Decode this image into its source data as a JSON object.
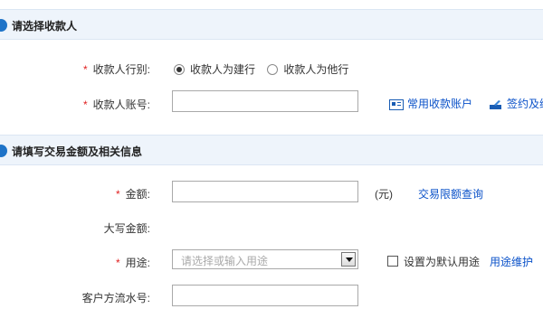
{
  "payee_section": {
    "title": "请选择收款人",
    "type_label": "收款人行别:",
    "type_options": [
      "收款人为建行",
      "收款人为他行"
    ],
    "account_label": "收款人账号:",
    "common_accounts_link": "常用收款账户",
    "sign_link": "签约及维护"
  },
  "amount_section": {
    "title": "请填写交易金额及相关信息",
    "amount_label": "金额:",
    "currency_unit": "(元)",
    "limit_query_link": "交易限额查询",
    "uppercase_label": "大写金额:",
    "purpose_label": "用途:",
    "purpose_placeholder": "请选择或输入用途",
    "default_purpose_label": "设置为默认用途",
    "purpose_maintain_link": "用途维护",
    "serial_label": "客户方流水号:"
  },
  "required_mark": "*",
  "colors": {
    "section_bg": "#eef4fb",
    "accent": "#1e73c8",
    "link": "#0b52c9",
    "required": "#e02020"
  }
}
